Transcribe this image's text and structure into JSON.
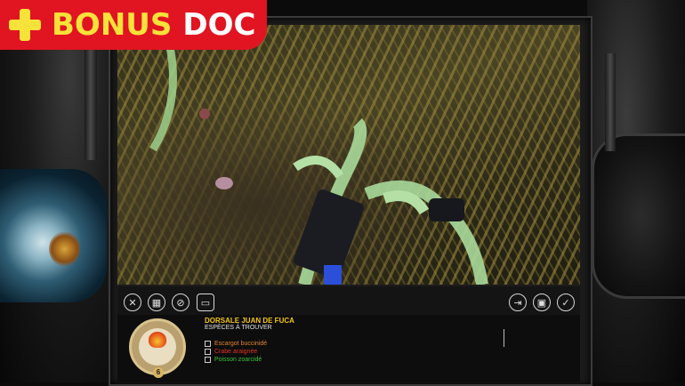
{
  "logo": {
    "word1": "BONUS",
    "word2": "DOC",
    "icon": "plus-icon"
  },
  "toolbar": {
    "left_buttons": [
      {
        "icon": "satellite-icon",
        "glyph": "✕"
      },
      {
        "icon": "grid-icon",
        "glyph": "▦"
      },
      {
        "icon": "search-species-icon",
        "glyph": "⊘"
      },
      {
        "icon": "chat-icon",
        "glyph": "▭"
      }
    ],
    "right_buttons": [
      {
        "icon": "exit-icon",
        "glyph": "⇥"
      },
      {
        "icon": "save-icon",
        "glyph": "▣"
      },
      {
        "icon": "checklist-icon",
        "glyph": "✓"
      }
    ]
  },
  "panel": {
    "title": "DORSALE JUAN DE FUCA",
    "subtitle": "ESPÈCES À TROUVER",
    "avatar_badge": "6",
    "species": [
      {
        "name": "Escargot buccinidé",
        "color": "#e3842f"
      },
      {
        "name": "Crabe araignée",
        "color": "#e03326"
      },
      {
        "name": "Poisson zoarcidé",
        "color": "#37c43a"
      }
    ]
  },
  "colors": {
    "brand_red": "#e11422",
    "brand_yellow": "#f7e23a",
    "title_yellow": "#f5c518"
  }
}
